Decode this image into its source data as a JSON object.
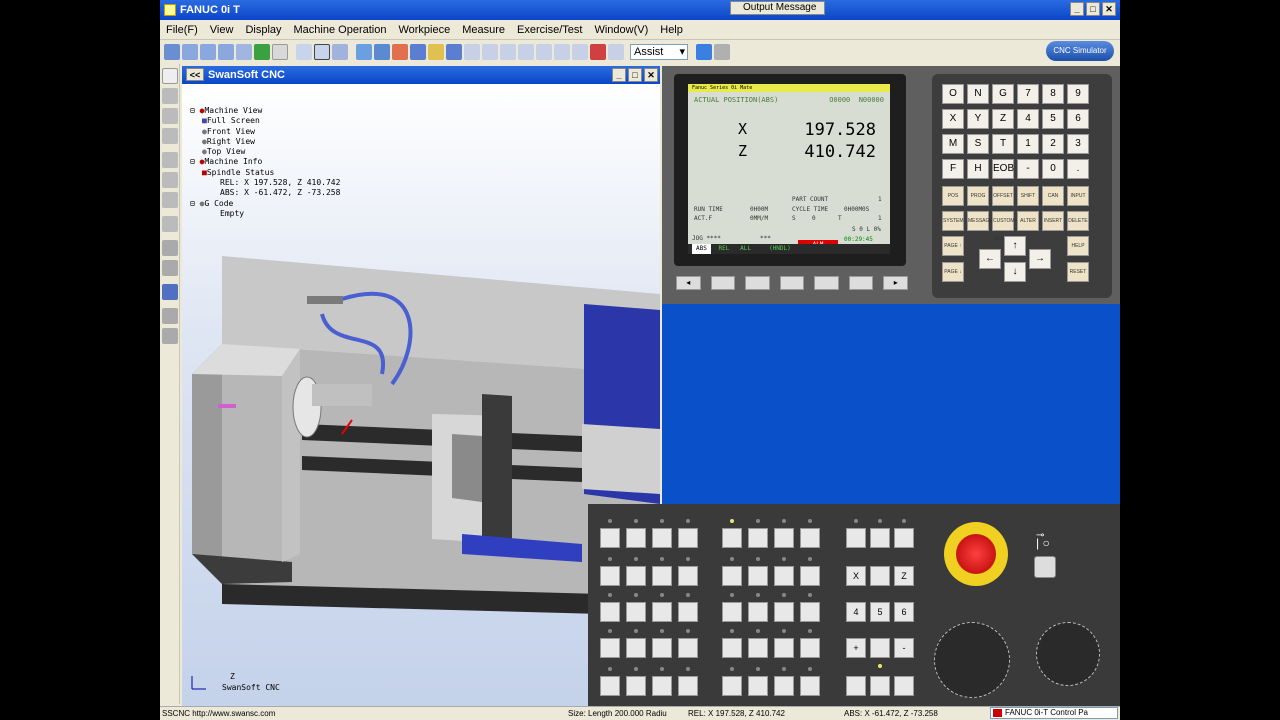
{
  "window": {
    "title": "FANUC 0i T",
    "output_message_tab": "Output Message",
    "min": "_",
    "max": "□",
    "close": "✕"
  },
  "menu": [
    "File(F)",
    "View",
    "Display",
    "Machine Operation",
    "Workpiece",
    "Measure",
    "Exercise/Test",
    "Window(V)",
    "Help"
  ],
  "toolbar": {
    "assist_value": "Assist",
    "logo_text": "CNC Simulator"
  },
  "view3d": {
    "title": "SwanSoft CNC",
    "nav_label": "<<",
    "tree": [
      {
        "text": "Machine View",
        "level": 1
      },
      {
        "text": "Full Screen",
        "level": 2
      },
      {
        "text": "Front View",
        "level": 2
      },
      {
        "text": "Right View",
        "level": 2
      },
      {
        "text": "Top View",
        "level": 2
      },
      {
        "text": "Machine Info",
        "level": 1
      },
      {
        "text": "Spindle Status",
        "level": 2
      },
      {
        "text": "REL: X 197.528, Z 410.742",
        "level": 3
      },
      {
        "text": "ABS: X -61.472, Z -73.258",
        "level": 3
      },
      {
        "text": "G Code",
        "level": 1
      },
      {
        "text": "Empty",
        "level": 2
      }
    ],
    "axis_caption": "SwanSoft CNC",
    "axis_z": "Z"
  },
  "crt": {
    "header": "Fanuc Series 0i Mate",
    "title": "ACTUAL POSITION(ABS)",
    "prog": "O0000",
    "seq": "N00000",
    "x_label": "X",
    "x_value": "197.528",
    "z_label": "Z",
    "z_value": "410.742",
    "part_count": "PART COUNT",
    "part_count_val": "1",
    "run_time": "RUN TIME",
    "run_time_val": "0H00M",
    "cycle_time": "CYCLE TIME",
    "cycle_time_val": "0H00M0S",
    "act_f": "ACT.F",
    "act_f_val": "0MM/M",
    "s_label": "S",
    "s_val": "0",
    "t_label": "T",
    "t_val": "1",
    "s_pct": "S 0 L 0%",
    "mode": "JOG ****",
    "stars": "***",
    "alm": "ALM",
    "clock": "00:29:45",
    "abs_tab": "ABS",
    "rel_tab": "REL",
    "all_tab": "ALL",
    "hndl_tab": "(HNDL)"
  },
  "keypad": {
    "address_keys": [
      "O",
      "N",
      "G",
      "7",
      "8",
      "9",
      "X",
      "Y",
      "Z",
      "4",
      "5",
      "6",
      "M",
      "S",
      "T",
      "1",
      "2",
      "3",
      "F",
      "H",
      "EOB",
      "-",
      "0",
      "."
    ],
    "function_keys": [
      "POS",
      "PROG",
      "OFFSET SETTING",
      "SHIFT",
      "CAN",
      "INPUT",
      "SYSTEM",
      "MESSAGE",
      "CUSTOM GRAPH",
      "ALTER",
      "INSERT",
      "DELETE"
    ],
    "page_up": "PAGE ↑",
    "page_down": "PAGE ↓",
    "help": "HELP",
    "reset": "RESET"
  },
  "machine": {
    "x_key": "X",
    "z_key": "Z",
    "num_keys": [
      "4",
      "5",
      "6"
    ],
    "plus": "+",
    "minus": "-"
  },
  "status": {
    "left": "SSCNC http://www.swansc.com",
    "size": "Size: Length 200.000 Radiu",
    "rel": "REL: X 197.528, Z 410.742",
    "abs": "ABS: X -61.472, Z -73.258",
    "control": "FANUC 0i-T Control Pa"
  },
  "colors": {
    "title_blue": "#0a46c8",
    "panel_blue": "#0a50c8",
    "machine_blue": "#1c2fa0",
    "alarm_red": "#dd0000"
  }
}
